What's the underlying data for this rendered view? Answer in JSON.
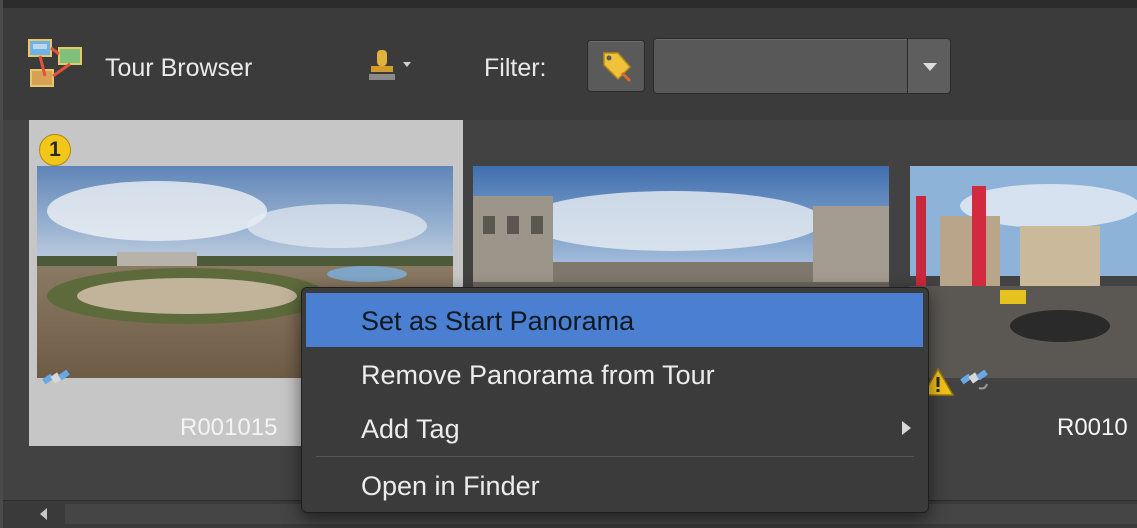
{
  "toolbar": {
    "title": "Tour Browser",
    "filter_label": "Filter:",
    "filter_value": ""
  },
  "thumbnails": [
    {
      "name": "R001015",
      "start_badge": "1",
      "selected": true,
      "warning": false
    },
    {
      "name": "",
      "selected": false,
      "warning": false
    },
    {
      "name": "R0010",
      "selected": false,
      "warning": true
    }
  ],
  "context_menu": {
    "items": [
      {
        "label": "Set as Start Panorama",
        "highlighted": true
      },
      {
        "label": "Remove Panorama from Tour"
      },
      {
        "label": "Add Tag",
        "submenu": true
      },
      {
        "label": "Open in Finder"
      }
    ]
  },
  "colors": {
    "highlight": "#4a7fd1",
    "badge": "#f3c71a",
    "background": "#3d3d3d"
  },
  "icons": {
    "app": "tour-browser-icon",
    "stamp": "stamp-icon",
    "tag": "tag-icon",
    "gps": "satellite-icon",
    "warning": "warning-icon"
  }
}
